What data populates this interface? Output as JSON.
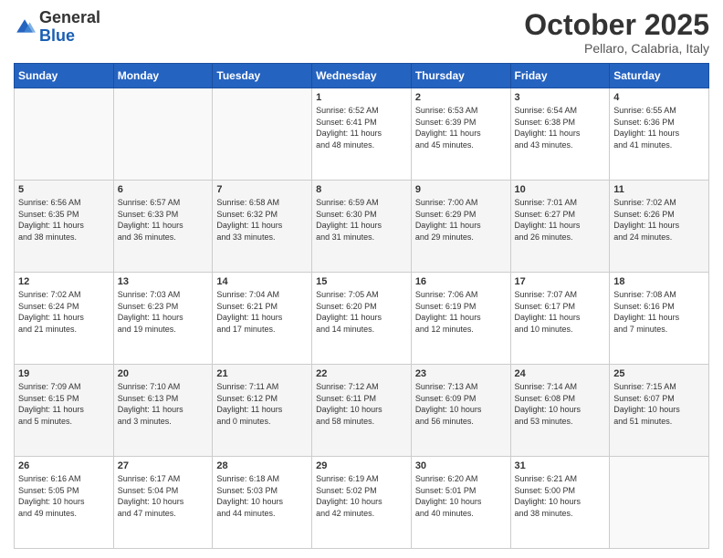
{
  "logo": {
    "general": "General",
    "blue": "Blue"
  },
  "header": {
    "month": "October 2025",
    "location": "Pellaro, Calabria, Italy"
  },
  "weekdays": [
    "Sunday",
    "Monday",
    "Tuesday",
    "Wednesday",
    "Thursday",
    "Friday",
    "Saturday"
  ],
  "weeks": [
    [
      {
        "day": "",
        "info": ""
      },
      {
        "day": "",
        "info": ""
      },
      {
        "day": "",
        "info": ""
      },
      {
        "day": "1",
        "info": "Sunrise: 6:52 AM\nSunset: 6:41 PM\nDaylight: 11 hours\nand 48 minutes."
      },
      {
        "day": "2",
        "info": "Sunrise: 6:53 AM\nSunset: 6:39 PM\nDaylight: 11 hours\nand 45 minutes."
      },
      {
        "day": "3",
        "info": "Sunrise: 6:54 AM\nSunset: 6:38 PM\nDaylight: 11 hours\nand 43 minutes."
      },
      {
        "day": "4",
        "info": "Sunrise: 6:55 AM\nSunset: 6:36 PM\nDaylight: 11 hours\nand 41 minutes."
      }
    ],
    [
      {
        "day": "5",
        "info": "Sunrise: 6:56 AM\nSunset: 6:35 PM\nDaylight: 11 hours\nand 38 minutes."
      },
      {
        "day": "6",
        "info": "Sunrise: 6:57 AM\nSunset: 6:33 PM\nDaylight: 11 hours\nand 36 minutes."
      },
      {
        "day": "7",
        "info": "Sunrise: 6:58 AM\nSunset: 6:32 PM\nDaylight: 11 hours\nand 33 minutes."
      },
      {
        "day": "8",
        "info": "Sunrise: 6:59 AM\nSunset: 6:30 PM\nDaylight: 11 hours\nand 31 minutes."
      },
      {
        "day": "9",
        "info": "Sunrise: 7:00 AM\nSunset: 6:29 PM\nDaylight: 11 hours\nand 29 minutes."
      },
      {
        "day": "10",
        "info": "Sunrise: 7:01 AM\nSunset: 6:27 PM\nDaylight: 11 hours\nand 26 minutes."
      },
      {
        "day": "11",
        "info": "Sunrise: 7:02 AM\nSunset: 6:26 PM\nDaylight: 11 hours\nand 24 minutes."
      }
    ],
    [
      {
        "day": "12",
        "info": "Sunrise: 7:02 AM\nSunset: 6:24 PM\nDaylight: 11 hours\nand 21 minutes."
      },
      {
        "day": "13",
        "info": "Sunrise: 7:03 AM\nSunset: 6:23 PM\nDaylight: 11 hours\nand 19 minutes."
      },
      {
        "day": "14",
        "info": "Sunrise: 7:04 AM\nSunset: 6:21 PM\nDaylight: 11 hours\nand 17 minutes."
      },
      {
        "day": "15",
        "info": "Sunrise: 7:05 AM\nSunset: 6:20 PM\nDaylight: 11 hours\nand 14 minutes."
      },
      {
        "day": "16",
        "info": "Sunrise: 7:06 AM\nSunset: 6:19 PM\nDaylight: 11 hours\nand 12 minutes."
      },
      {
        "day": "17",
        "info": "Sunrise: 7:07 AM\nSunset: 6:17 PM\nDaylight: 11 hours\nand 10 minutes."
      },
      {
        "day": "18",
        "info": "Sunrise: 7:08 AM\nSunset: 6:16 PM\nDaylight: 11 hours\nand 7 minutes."
      }
    ],
    [
      {
        "day": "19",
        "info": "Sunrise: 7:09 AM\nSunset: 6:15 PM\nDaylight: 11 hours\nand 5 minutes."
      },
      {
        "day": "20",
        "info": "Sunrise: 7:10 AM\nSunset: 6:13 PM\nDaylight: 11 hours\nand 3 minutes."
      },
      {
        "day": "21",
        "info": "Sunrise: 7:11 AM\nSunset: 6:12 PM\nDaylight: 11 hours\nand 0 minutes."
      },
      {
        "day": "22",
        "info": "Sunrise: 7:12 AM\nSunset: 6:11 PM\nDaylight: 10 hours\nand 58 minutes."
      },
      {
        "day": "23",
        "info": "Sunrise: 7:13 AM\nSunset: 6:09 PM\nDaylight: 10 hours\nand 56 minutes."
      },
      {
        "day": "24",
        "info": "Sunrise: 7:14 AM\nSunset: 6:08 PM\nDaylight: 10 hours\nand 53 minutes."
      },
      {
        "day": "25",
        "info": "Sunrise: 7:15 AM\nSunset: 6:07 PM\nDaylight: 10 hours\nand 51 minutes."
      }
    ],
    [
      {
        "day": "26",
        "info": "Sunrise: 6:16 AM\nSunset: 5:05 PM\nDaylight: 10 hours\nand 49 minutes."
      },
      {
        "day": "27",
        "info": "Sunrise: 6:17 AM\nSunset: 5:04 PM\nDaylight: 10 hours\nand 47 minutes."
      },
      {
        "day": "28",
        "info": "Sunrise: 6:18 AM\nSunset: 5:03 PM\nDaylight: 10 hours\nand 44 minutes."
      },
      {
        "day": "29",
        "info": "Sunrise: 6:19 AM\nSunset: 5:02 PM\nDaylight: 10 hours\nand 42 minutes."
      },
      {
        "day": "30",
        "info": "Sunrise: 6:20 AM\nSunset: 5:01 PM\nDaylight: 10 hours\nand 40 minutes."
      },
      {
        "day": "31",
        "info": "Sunrise: 6:21 AM\nSunset: 5:00 PM\nDaylight: 10 hours\nand 38 minutes."
      },
      {
        "day": "",
        "info": ""
      }
    ]
  ]
}
